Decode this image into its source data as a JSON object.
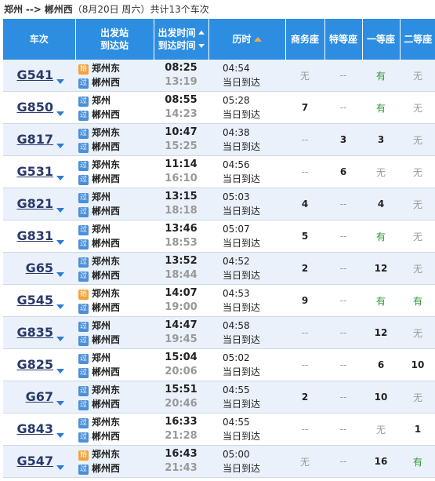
{
  "route": {
    "from": "郑州",
    "arrow": "-->",
    "to": "郴州西",
    "date": "（8月20日  周六）",
    "count": "共计13个车次"
  },
  "columns": {
    "train": "车次",
    "station_from": "出发站",
    "station_to": "到达站",
    "time_dep": "出发时间",
    "time_arr": "到达时间",
    "duration": "历时",
    "business": "商务座",
    "premium": "特等座",
    "first": "一等座",
    "second": "二等座"
  },
  "badges": {
    "start": "始",
    "pass": "过"
  },
  "icons": {
    "train_dropdown": "chevron-down-icon",
    "sort_dep": "sort-up-down-icon",
    "sort_duration": "sort-up-icon"
  },
  "colors": {
    "header_bg": "#2d8de1",
    "available": "#2e9a2e",
    "unavailable": "#999999",
    "start_badge": "#f3a33b",
    "pass_badge": "#4b8fd9"
  },
  "trains": [
    {
      "no": "G541",
      "from_badge": "始",
      "from": "郑州东",
      "to_badge": "过",
      "to": "郴州西",
      "dep": "08:25",
      "arr": "13:19",
      "dur": "04:54",
      "note": "当日到达",
      "business": "无",
      "premium": "--",
      "first": "有",
      "second": "无"
    },
    {
      "no": "G850",
      "from_badge": "过",
      "from": "郑州",
      "to_badge": "过",
      "to": "郴州西",
      "dep": "08:55",
      "arr": "14:23",
      "dur": "05:28",
      "note": "当日到达",
      "business": "7",
      "premium": "--",
      "first": "有",
      "second": "无"
    },
    {
      "no": "G817",
      "from_badge": "过",
      "from": "郑州东",
      "to_badge": "过",
      "to": "郴州西",
      "dep": "10:47",
      "arr": "15:25",
      "dur": "04:38",
      "note": "当日到达",
      "business": "--",
      "premium": "3",
      "first": "3",
      "second": "无"
    },
    {
      "no": "G531",
      "from_badge": "过",
      "from": "郑州东",
      "to_badge": "过",
      "to": "郴州西",
      "dep": "11:14",
      "arr": "16:10",
      "dur": "04:56",
      "note": "当日到达",
      "business": "--",
      "premium": "6",
      "first": "无",
      "second": "无"
    },
    {
      "no": "G821",
      "from_badge": "过",
      "from": "郑州",
      "to_badge": "过",
      "to": "郴州西",
      "dep": "13:15",
      "arr": "18:18",
      "dur": "05:03",
      "note": "当日到达",
      "business": "4",
      "premium": "--",
      "first": "4",
      "second": "无"
    },
    {
      "no": "G831",
      "from_badge": "过",
      "from": "郑州",
      "to_badge": "过",
      "to": "郴州西",
      "dep": "13:46",
      "arr": "18:53",
      "dur": "05:07",
      "note": "当日到达",
      "business": "5",
      "premium": "--",
      "first": "有",
      "second": "无"
    },
    {
      "no": "G65",
      "from_badge": "过",
      "from": "郑州东",
      "to_badge": "过",
      "to": "郴州西",
      "dep": "13:52",
      "arr": "18:44",
      "dur": "04:52",
      "note": "当日到达",
      "business": "2",
      "premium": "--",
      "first": "12",
      "second": "无"
    },
    {
      "no": "G545",
      "from_badge": "始",
      "from": "郑州东",
      "to_badge": "过",
      "to": "郴州西",
      "dep": "14:07",
      "arr": "19:00",
      "dur": "04:53",
      "note": "当日到达",
      "business": "9",
      "premium": "--",
      "first": "有",
      "second": "有"
    },
    {
      "no": "G835",
      "from_badge": "过",
      "from": "郑州",
      "to_badge": "过",
      "to": "郴州西",
      "dep": "14:47",
      "arr": "19:45",
      "dur": "04:58",
      "note": "当日到达",
      "business": "--",
      "premium": "--",
      "first": "12",
      "second": "无"
    },
    {
      "no": "G825",
      "from_badge": "过",
      "from": "郑州",
      "to_badge": "过",
      "to": "郴州西",
      "dep": "15:04",
      "arr": "20:06",
      "dur": "05:02",
      "note": "当日到达",
      "business": "--",
      "premium": "--",
      "first": "6",
      "second": "10"
    },
    {
      "no": "G67",
      "from_badge": "过",
      "from": "郑州东",
      "to_badge": "过",
      "to": "郴州西",
      "dep": "15:51",
      "arr": "20:46",
      "dur": "04:55",
      "note": "当日到达",
      "business": "2",
      "premium": "--",
      "first": "10",
      "second": "无"
    },
    {
      "no": "G843",
      "from_badge": "过",
      "from": "郑州东",
      "to_badge": "过",
      "to": "郴州西",
      "dep": "16:33",
      "arr": "21:28",
      "dur": "04:55",
      "note": "当日到达",
      "business": "--",
      "premium": "--",
      "first": "无",
      "second": "1"
    },
    {
      "no": "G547",
      "from_badge": "始",
      "from": "郑州东",
      "to_badge": "过",
      "to": "郴州西",
      "dep": "16:43",
      "arr": "21:43",
      "dur": "05:00",
      "note": "当日到达",
      "business": "无",
      "premium": "--",
      "first": "16",
      "second": "有"
    }
  ]
}
